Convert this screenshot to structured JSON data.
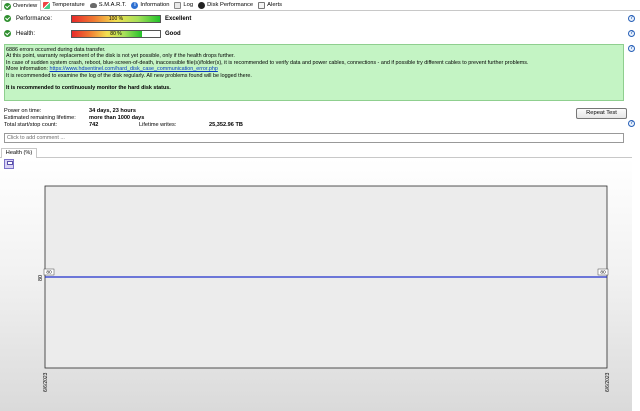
{
  "tabs": [
    {
      "label": "Overview",
      "icon": "check-icon",
      "active": true
    },
    {
      "label": "Temperature",
      "icon": "thermometer-icon"
    },
    {
      "label": "S.M.A.R.T.",
      "icon": "smart-icon"
    },
    {
      "label": "Information",
      "icon": "info-icon"
    },
    {
      "label": "Log",
      "icon": "log-icon"
    },
    {
      "label": "Disk Performance",
      "icon": "performance-icon"
    },
    {
      "label": "Alerts",
      "icon": "alerts-icon"
    }
  ],
  "performance": {
    "label": "Performance:",
    "value_text": "100 %",
    "value": 100,
    "rating": "Excellent"
  },
  "health": {
    "label": "Health:",
    "value_text": "80 %",
    "value": 80,
    "rating": "Good"
  },
  "message": {
    "line1": "6886 errors occurred during data transfer.",
    "line2": "At this point, warranty replacement of the disk is not yet possible, only if the health drops further.",
    "line3": "In case of sudden system crash, reboot, blue-screen-of-death, inaccessible file(s)/folder(s), it is recommended to verify data and power cables, connections - and if possible try different cables to prevent further problems.",
    "more_info_label": "More information: ",
    "more_info_link": "https://www.hdsentinel.com/hard_disk_case_communication_error.php",
    "line5": "It is recommended to examine the log of the disk regularly. All new problems found will be logged there.",
    "recommendation": "It is recommended to continuously monitor the hard disk status."
  },
  "stats": {
    "power_on_label": "Power on time:",
    "power_on_value": "34 days, 23 hours",
    "remaining_label": "Estimated remaining lifetime:",
    "remaining_value": "more than 1000 days",
    "startstop_label": "Total start/stop count:",
    "startstop_value": "742",
    "writes_label": "Lifetime writes:",
    "writes_value": "25,352.96 TB"
  },
  "repeat_test_label": "Repeat Test",
  "comment_placeholder": "Click to add comment ...",
  "chart_tab_label": "Health (%)",
  "colors": {
    "message_bg": "#c4f4c4",
    "series": "#1f2fcc",
    "link": "#0b3cc2"
  },
  "chart_data": {
    "type": "line",
    "title": "",
    "xlabel": "",
    "ylabel": "",
    "x": [
      "6/6/2023",
      "6/6/2023"
    ],
    "series": [
      {
        "values": [
          80,
          80
        ]
      }
    ],
    "y_tick_labels": [
      "80"
    ],
    "point_labels": [
      "80",
      "80"
    ],
    "ylim": [
      0,
      160
    ],
    "grid": false,
    "legend": "none"
  }
}
